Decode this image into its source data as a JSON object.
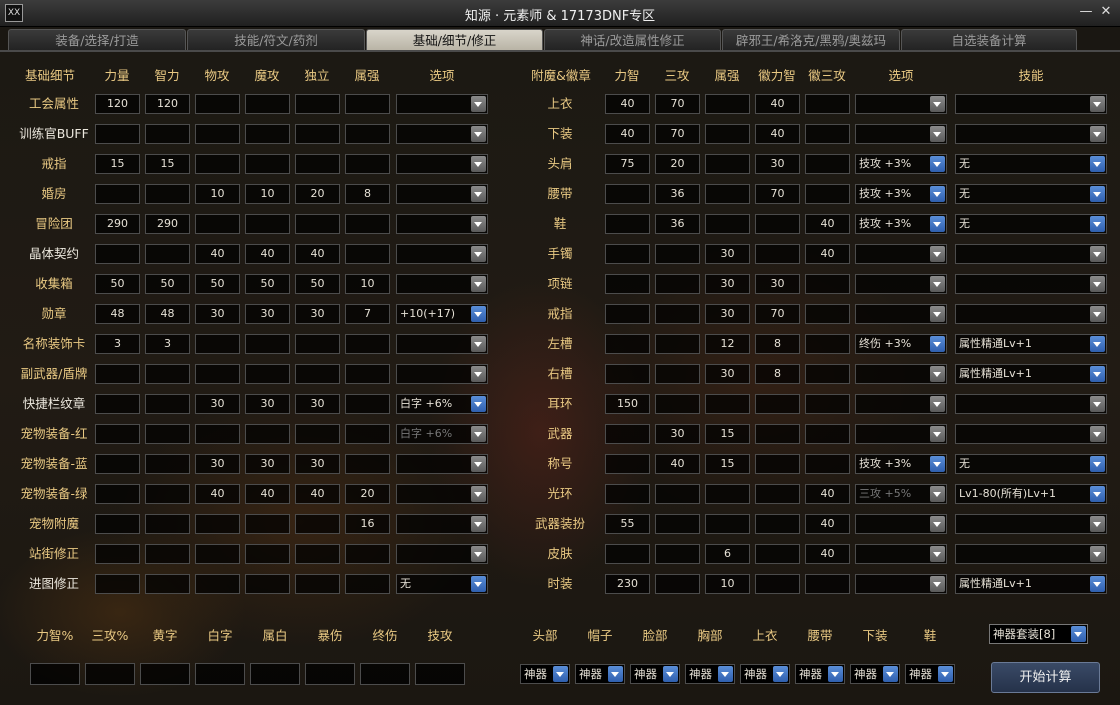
{
  "window": {
    "title": "知源 · 元素师 & 17173DNF专区",
    "icon_text": "XX",
    "minimize": "—",
    "close": "✕"
  },
  "tabs": [
    "装备/选择/打造",
    "技能/符文/药剂",
    "基础/细节/修正",
    "神话/改造属性修正",
    "辟邪王/希洛克/黑鸦/奥兹玛",
    "自选装备计算"
  ],
  "active_tab": 2,
  "left_headers": [
    "基础细节",
    "力量",
    "智力",
    "物攻",
    "魔攻",
    "独立",
    "属强",
    "选项"
  ],
  "left_rows": [
    {
      "label": "工会属性",
      "v": [
        "120",
        "120",
        "",
        "",
        "",
        ""
      ],
      "opt": ""
    },
    {
      "label": "训练官BUFF",
      "v": [
        "",
        "",
        "",
        "",
        "",
        ""
      ],
      "opt": ""
    },
    {
      "label": "戒指",
      "v": [
        "15",
        "15",
        "",
        "",
        "",
        ""
      ],
      "opt": ""
    },
    {
      "label": "婚房",
      "v": [
        "",
        "",
        "10",
        "10",
        "20",
        "8"
      ],
      "opt": ""
    },
    {
      "label": "冒险团",
      "v": [
        "290",
        "290",
        "",
        "",
        "",
        ""
      ],
      "opt": ""
    },
    {
      "label": "晶体契约",
      "v": [
        "",
        "",
        "40",
        "40",
        "40",
        ""
      ],
      "opt": ""
    },
    {
      "label": "收集箱",
      "v": [
        "50",
        "50",
        "50",
        "50",
        "50",
        "10"
      ],
      "opt": ""
    },
    {
      "label": "勋章",
      "v": [
        "48",
        "48",
        "30",
        "30",
        "30",
        "7"
      ],
      "opt": "+10(+17)"
    },
    {
      "label": "名称装饰卡",
      "v": [
        "3",
        "3",
        "",
        "",
        "",
        ""
      ],
      "opt": ""
    },
    {
      "label": "副武器/盾牌",
      "v": [
        "",
        "",
        "",
        "",
        "",
        ""
      ],
      "opt": ""
    },
    {
      "label": "快捷栏纹章",
      "v": [
        "",
        "",
        "30",
        "30",
        "30",
        ""
      ],
      "opt": "白字 +6%"
    },
    {
      "label": "宠物装备-红",
      "v": [
        "",
        "",
        "",
        "",
        "",
        ""
      ],
      "opt": "白字 +6%"
    },
    {
      "label": "宠物装备-蓝",
      "v": [
        "",
        "",
        "30",
        "30",
        "30",
        ""
      ],
      "opt": ""
    },
    {
      "label": "宠物装备-绿",
      "v": [
        "",
        "",
        "40",
        "40",
        "40",
        "20"
      ],
      "opt": ""
    },
    {
      "label": "宠物附魔",
      "v": [
        "",
        "",
        "",
        "",
        "",
        "16"
      ],
      "opt": ""
    },
    {
      "label": "站街修正",
      "v": [
        "",
        "",
        "",
        "",
        "",
        ""
      ],
      "opt": ""
    },
    {
      "label": "进图修正",
      "v": [
        "",
        "",
        "",
        "",
        "",
        ""
      ],
      "opt": "无"
    }
  ],
  "right_headers": [
    "附魔&徽章",
    "力智",
    "三攻",
    "属强",
    "徽力智",
    "徽三攻",
    "选项",
    "技能"
  ],
  "right_rows": [
    {
      "label": "上衣",
      "v": [
        "40",
        "70",
        "",
        "40",
        ""
      ],
      "opt": "",
      "skill": ""
    },
    {
      "label": "下装",
      "v": [
        "40",
        "70",
        "",
        "40",
        ""
      ],
      "opt": "",
      "skill": ""
    },
    {
      "label": "头肩",
      "v": [
        "75",
        "20",
        "",
        "30",
        ""
      ],
      "opt": "技攻 +3%",
      "skill": "无"
    },
    {
      "label": "腰带",
      "v": [
        "",
        "36",
        "",
        "70",
        ""
      ],
      "opt": "技攻 +3%",
      "skill": "无"
    },
    {
      "label": "鞋",
      "v": [
        "",
        "36",
        "",
        "",
        "40"
      ],
      "opt": "技攻 +3%",
      "skill": "无"
    },
    {
      "label": "手镯",
      "v": [
        "",
        "",
        "30",
        "",
        "40"
      ],
      "opt": "",
      "skill": ""
    },
    {
      "label": "项链",
      "v": [
        "",
        "",
        "30",
        "30",
        ""
      ],
      "opt": "",
      "skill": ""
    },
    {
      "label": "戒指",
      "v": [
        "",
        "",
        "30",
        "70",
        ""
      ],
      "opt": "",
      "skill": ""
    },
    {
      "label": "左槽",
      "v": [
        "",
        "",
        "12",
        "8",
        ""
      ],
      "opt": "终伤 +3%",
      "skill": "属性精通Lv+1"
    },
    {
      "label": "右槽",
      "v": [
        "",
        "",
        "30",
        "8",
        ""
      ],
      "opt": "",
      "skill": "属性精通Lv+1"
    },
    {
      "label": "耳环",
      "v": [
        "150",
        "",
        "",
        "",
        ""
      ],
      "opt": "",
      "skill": ""
    },
    {
      "label": "武器",
      "v": [
        "",
        "30",
        "15",
        "",
        ""
      ],
      "opt": "",
      "skill": ""
    },
    {
      "label": "称号",
      "v": [
        "",
        "40",
        "15",
        "",
        ""
      ],
      "opt": "技攻 +3%",
      "skill": "无"
    },
    {
      "label": "光环",
      "v": [
        "",
        "",
        "",
        "",
        "40"
      ],
      "opt": "三攻 +5%",
      "skill": "Lv1-80(所有)Lv+1"
    },
    {
      "label": "武器装扮",
      "v": [
        "55",
        "",
        "",
        "",
        "40"
      ],
      "opt": "",
      "skill": ""
    },
    {
      "label": "皮肤",
      "v": [
        "",
        "",
        "6",
        "",
        "40"
      ],
      "opt": "",
      "skill": ""
    },
    {
      "label": "时装",
      "v": [
        "230",
        "",
        "10",
        "",
        ""
      ],
      "opt": "",
      "skill": "属性精通Lv+1"
    }
  ],
  "bottom_left_labels": [
    "力智%",
    "三攻%",
    "黄字",
    "白字",
    "属白",
    "暴伤",
    "终伤",
    "技攻"
  ],
  "bottom_right_labels": [
    "头部",
    "帽子",
    "脸部",
    "胸部",
    "上衣",
    "腰带",
    "下装",
    "鞋"
  ],
  "bottom_right_value": "神器",
  "set_select": "神器套装[8]",
  "calc_button": "开始计算"
}
